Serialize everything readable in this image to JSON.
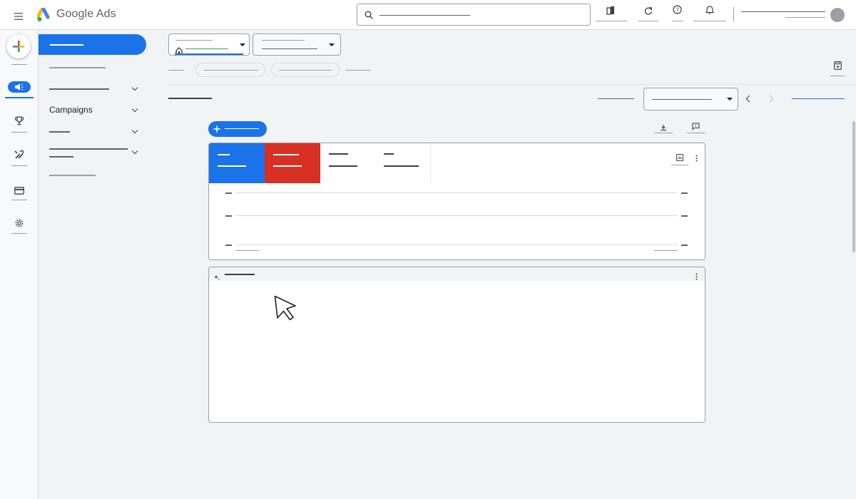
{
  "app": {
    "brand": "Google Ads"
  },
  "sidebar": {
    "campaigns_label": "Campaigns"
  },
  "colors": {
    "primary": "#1a73e8",
    "accent_red": "#d93025",
    "avatar": "#9aa0a6"
  },
  "icons": {
    "menu": "menu-icon",
    "search": "search-icon",
    "tools": "tools-icon",
    "refresh": "refresh-icon",
    "help": "help-icon",
    "bell": "bell-icon",
    "create": "plus-icon",
    "campaigns": "megaphone-icon",
    "goals": "trophy-icon",
    "admin": "wrench-icon",
    "billing": "card-icon",
    "settings": "gear-icon",
    "download": "download-icon",
    "feedback": "feedback-icon",
    "chart": "chart-icon",
    "more": "more-vert-icon",
    "insights": "sparkle-icon",
    "prev": "chevron-left-icon",
    "next": "chevron-right-icon",
    "save": "save-icon"
  }
}
